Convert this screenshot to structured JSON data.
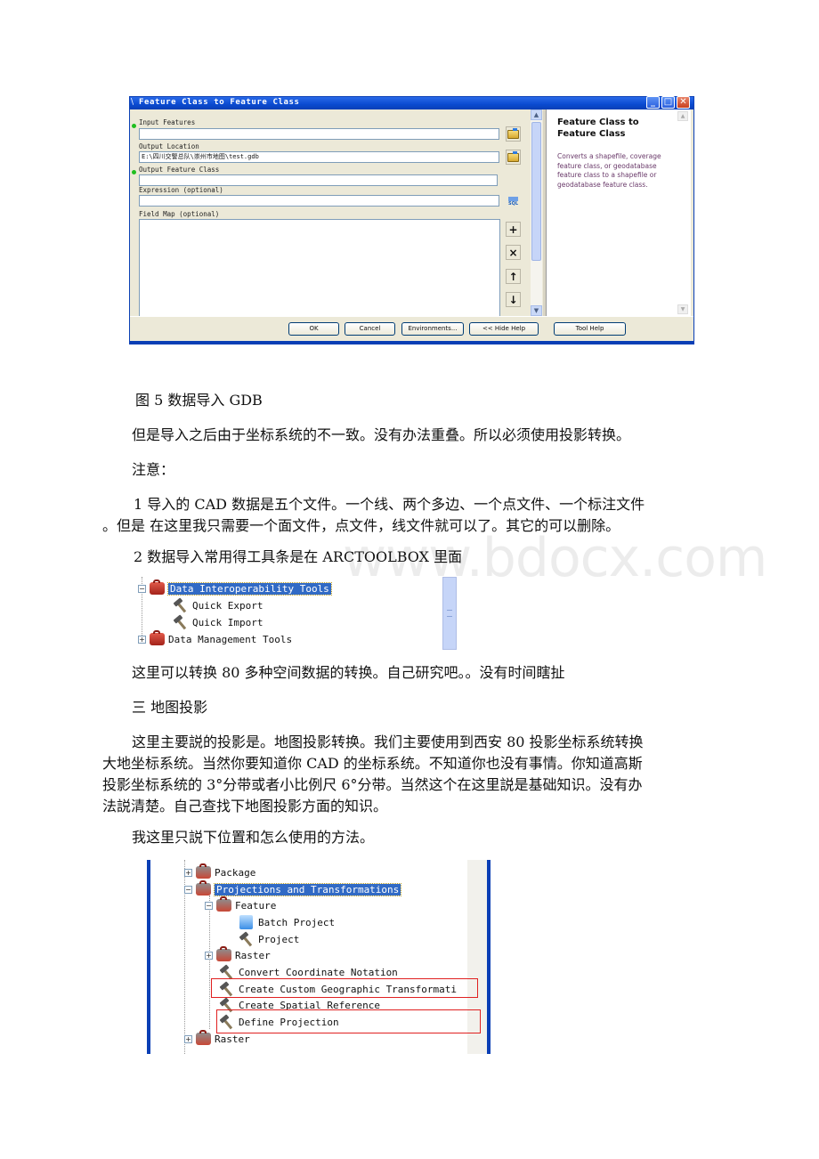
{
  "dialog": {
    "title": "Feature Class to Feature Class",
    "window_buttons": {
      "minimize": "_",
      "maximize": "□",
      "close": "✕"
    },
    "fields": [
      {
        "label": "Input Features",
        "value": "",
        "required": true
      },
      {
        "label": "Output Location",
        "value": "E:\\四川交警总队\\崇州市地图\\test.gdb",
        "required": false
      },
      {
        "label": "Output Feature Class",
        "value": "",
        "required": true
      },
      {
        "label": "Expression (optional)",
        "value": "",
        "required": false
      },
      {
        "label": "Field Map (optional)",
        "value": "",
        "required": false
      }
    ],
    "side_buttons": {
      "add": "+",
      "remove": "×",
      "up": "↑",
      "down": "↓",
      "sql": "SQL"
    },
    "help": {
      "title": "Feature Class to Feature Class",
      "description": "Converts a shapefile, coverage feature class, or geodatabase feature class to a shapefile or geodatabase feature class."
    },
    "buttons": {
      "ok": "OK",
      "cancel": "Cancel",
      "environments": "Environments...",
      "hide_help": "<< Hide Help",
      "tool_help": "Tool Help"
    }
  },
  "document": {
    "caption": "图 5 数据导入 GDB",
    "p1": "但是导入之后由于坐标系统的不一致。没有办法重叠。所以必须使用投影转换。",
    "note_label": "注意：",
    "note1_line1": "1 导入的 CAD 数据是五个文件。一个线、两个多边、一个点文件、一个标注文件",
    "note1_line2": "。但是 在这里我只需要一个面文件，点文件，线文件就可以了。其它的可以删除。",
    "note2": "2 数据导入常用得工具条是在 ARCTOOLBOX 里面",
    "p_convert": "这里可以转换 80 多种空间数据的转换。自己研究吧。。没有时间瞎扯",
    "section3": "三 地图投影",
    "proj_line1": "这里主要説的投影是。地图投影转换。我们主要使用到西安 80 投影坐标系统转换",
    "proj_line2": "大地坐标系统。当然你要知道你 CAD 的坐标系统。不知道你也没有事情。你知道高斯",
    "proj_line3": "投影坐标系统的 3°分带或者小比例尺 6°分带。当然这个在这里説是基础知识。没有办",
    "proj_line4": "法説清楚。自己查找下地图投影方面的知识。",
    "p_usage": "我这里只説下位置和怎么使用的方法。",
    "watermark": "www.bdocx.com"
  },
  "toolbox1": {
    "items": [
      {
        "label": "Data Interoperability Tools",
        "type": "toolbox",
        "expander": "−",
        "selected": true
      },
      {
        "label": "Quick Export",
        "type": "tool"
      },
      {
        "label": "Quick Import",
        "type": "tool"
      },
      {
        "label": "Data Management Tools",
        "type": "toolbox",
        "expander": "+"
      }
    ]
  },
  "toolbox2": {
    "items": [
      {
        "label": "Package",
        "type": "toolset",
        "expander": "+"
      },
      {
        "label": "Projections and Transformations",
        "type": "toolset",
        "expander": "−",
        "selected": true
      },
      {
        "label": "Feature",
        "type": "toolset",
        "expander": "−"
      },
      {
        "label": "Batch Project",
        "type": "script"
      },
      {
        "label": "Project",
        "type": "tool"
      },
      {
        "label": "Raster",
        "type": "toolset",
        "expander": "+"
      },
      {
        "label": "Convert Coordinate Notation",
        "type": "tool"
      },
      {
        "label": "Create Custom Geographic Transformati",
        "type": "tool",
        "highlighted": true
      },
      {
        "label": "Create Spatial Reference",
        "type": "tool"
      },
      {
        "label": "Define Projection",
        "type": "tool",
        "highlighted": true
      },
      {
        "label": "Raster",
        "type": "toolset",
        "expander": "+"
      }
    ],
    "highlight_color": "#e02020"
  }
}
